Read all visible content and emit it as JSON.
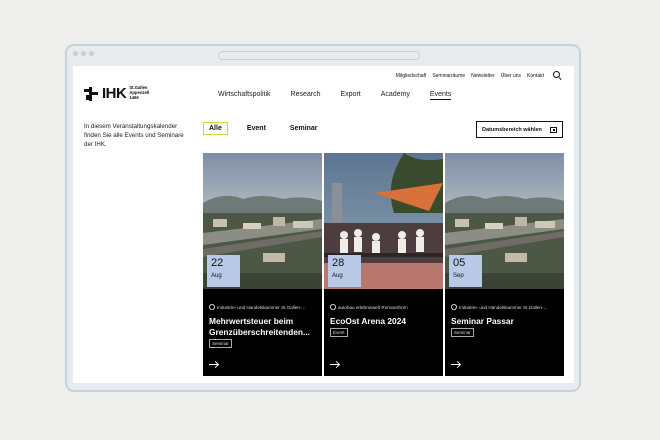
{
  "util_nav": [
    "Mitgliedschaft",
    "Seminarräume",
    "Newsletter",
    "Über uns",
    "Kontakt"
  ],
  "logo": {
    "word": "IHK",
    "sub1": "St.Gallen",
    "sub2": "Appenzell",
    "sub3": "1466"
  },
  "main_nav": [
    {
      "label": "Wirtschaftspolitik",
      "active": false
    },
    {
      "label": "Research",
      "active": false
    },
    {
      "label": "Export",
      "active": false
    },
    {
      "label": "Academy",
      "active": false
    },
    {
      "label": "Events",
      "active": true
    }
  ],
  "intro": "In diesem Veranstaltungskalender finden Sie alle Events und Seminare der IHK.",
  "filters": [
    {
      "label": "Alle",
      "active": true
    },
    {
      "label": "Event",
      "active": false
    },
    {
      "label": "Seminar",
      "active": false
    }
  ],
  "date_button": "Datumsbereich wählen",
  "events": [
    {
      "day": "22",
      "month": "Aug",
      "location": "Industrie- und Handelskammer St.Gallen-...",
      "title": "Mehrwertsteuer beim Grenzüberschreitenden...",
      "badge": "Seminar"
    },
    {
      "day": "28",
      "month": "Aug",
      "location": "autobau erlebniswelt Romanshorn",
      "title": "EcoOst Arena 2024",
      "badge": "Event"
    },
    {
      "day": "05",
      "month": "Sep",
      "location": "Industrie- und Handelskammer St.Gallen-...",
      "title": "Seminar Passar",
      "badge": "Seminar"
    }
  ],
  "colors": {
    "date_box": "#b9cae8",
    "filter_active_border": "#c8d93a",
    "card_bg": "#000000"
  }
}
